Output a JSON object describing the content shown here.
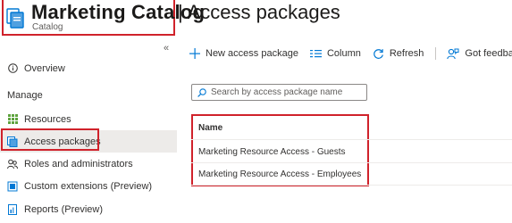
{
  "header": {
    "title": "Marketing Catalog",
    "subtitle": "Catalog",
    "section": "| Access packages",
    "more": "···"
  },
  "sidebar": {
    "collapse_glyph": "«",
    "top_item": {
      "label": "Overview",
      "icon": "info-icon"
    },
    "section_label": "Manage",
    "items": [
      {
        "label": "Resources",
        "icon": "resources-grid-icon"
      },
      {
        "label": "Access packages",
        "icon": "access-package-icon",
        "selected": true
      },
      {
        "label": "Roles and administrators",
        "icon": "people-icon"
      },
      {
        "label": "Custom extensions (Preview)",
        "icon": "extension-icon"
      },
      {
        "label": "Reports (Preview)",
        "icon": "report-icon"
      }
    ]
  },
  "toolbar": {
    "new_label": "New access package",
    "column_label": "Column",
    "refresh_label": "Refresh",
    "feedback_label": "Got feedback?"
  },
  "search": {
    "placeholder": "Search by access package name",
    "value": ""
  },
  "table": {
    "columns": [
      "Name"
    ],
    "rows": [
      "Marketing Resource Access - Guests",
      "Marketing Resource Access - Employees"
    ]
  },
  "colors": {
    "highlight": "#d0222b",
    "accent": "#0078d4",
    "selected_bg": "#edebe9"
  }
}
